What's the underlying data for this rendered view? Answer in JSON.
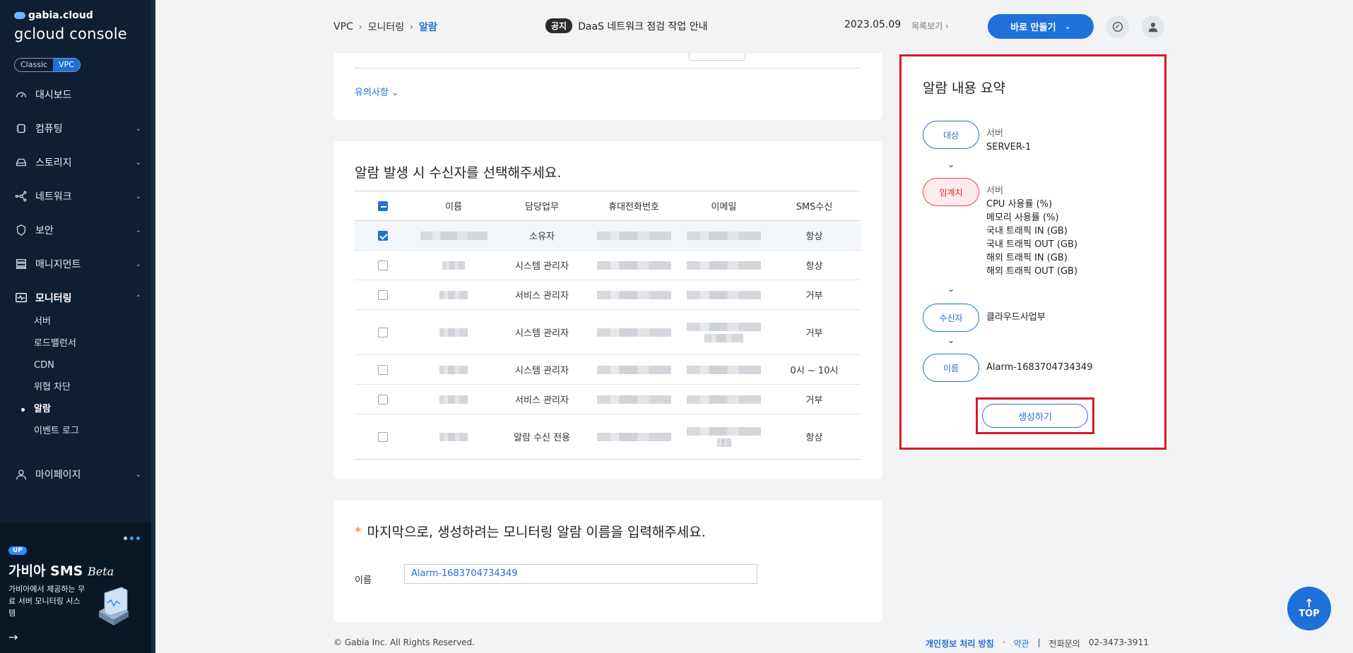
{
  "app": {
    "brand_small": "gabia.cloud",
    "brand_big": "gcloud console",
    "modes": [
      "Classic",
      "VPC"
    ],
    "active_mode": "VPC"
  },
  "sidebar": {
    "items": [
      {
        "label": "대시보드",
        "icon": "dashboard-icon"
      },
      {
        "label": "컴퓨팅",
        "icon": "chip-icon"
      },
      {
        "label": "스토리지",
        "icon": "storage-icon"
      },
      {
        "label": "네트워크",
        "icon": "network-icon"
      },
      {
        "label": "보안",
        "icon": "shield-icon"
      },
      {
        "label": "매니지먼트",
        "icon": "management-icon"
      },
      {
        "label": "모니터링",
        "icon": "monitor-icon"
      },
      {
        "label": "마이페이지",
        "icon": "user-icon"
      }
    ],
    "monitoring_sub": [
      "서버",
      "로드밸런서",
      "CDN",
      "위협 차단",
      "알람",
      "이벤트 로그"
    ],
    "active_sub": "알람"
  },
  "promo": {
    "badge": "UP",
    "title": "가비아 SMS",
    "title_em": "Beta",
    "desc": "가비아에서 제공하는 무료 서버 모니터링 시스템"
  },
  "header": {
    "breadcrumb": [
      "VPC",
      "모니터링",
      "알람"
    ],
    "notice_tag": "공지",
    "notice_text": "DaaS 네트워크 점검 작업 안내",
    "notice_date": "2023.05.09",
    "notice_list": "목록보기",
    "create_label": "바로 만들기"
  },
  "caution_label": "유의사항",
  "recipients": {
    "heading": "알람 발생 시 수신자를 선택해주세요.",
    "columns": [
      "이름",
      "담당업무",
      "휴대전화번호",
      "이메일",
      "SMS수신"
    ],
    "rows": [
      {
        "checked": true,
        "role": "소유자",
        "sms": "항상"
      },
      {
        "checked": false,
        "role": "시스템 관리자",
        "sms": "항상"
      },
      {
        "checked": false,
        "role": "서비스 관리자",
        "sms": "거부"
      },
      {
        "checked": false,
        "role": "시스템 관리자",
        "sms": "거부"
      },
      {
        "checked": false,
        "role": "시스템 관리자",
        "sms": "0시 ~ 10시"
      },
      {
        "checked": false,
        "role": "서비스 관리자",
        "sms": "거부"
      },
      {
        "checked": false,
        "role": "알람 수신 전용",
        "sms": "항상"
      }
    ]
  },
  "name_section": {
    "heading": "마지막으로, 생성하려는 모니터링 알람 이름을 입력해주세요.",
    "label": "이름",
    "value": "Alarm-1683704734349"
  },
  "summary": {
    "title": "알람 내용 요약",
    "target_label": "대상",
    "target_type": "서버",
    "target_value": "SERVER-1",
    "threshold_label": "임계치",
    "threshold_type": "서버",
    "threshold_items": [
      "CPU 사용률 (%)",
      "메모리 사용률 (%)",
      "국내 트래픽 IN (GB)",
      "국내 트래픽 OUT (GB)",
      "해외 트래픽 IN (GB)",
      "해외 트래픽 OUT (GB)"
    ],
    "recipient_label": "수신자",
    "recipient_value": "클라우드사업부",
    "name_label": "이름",
    "name_value": "Alarm-1683704734349",
    "create_label": "생성하기"
  },
  "footer": {
    "copyright": "© Gabia Inc. All Rights Reserved.",
    "privacy": "개인정보 처리 방침",
    "dot": "·",
    "terms": "약관",
    "bar": "|",
    "contact_label": "전화문의",
    "contact_number": "02-3473-3911"
  },
  "top_label": "TOP",
  "colors": {
    "accent": "#1f70d8",
    "highlight": "#d9182a",
    "sidebar": "#0f1f33"
  }
}
